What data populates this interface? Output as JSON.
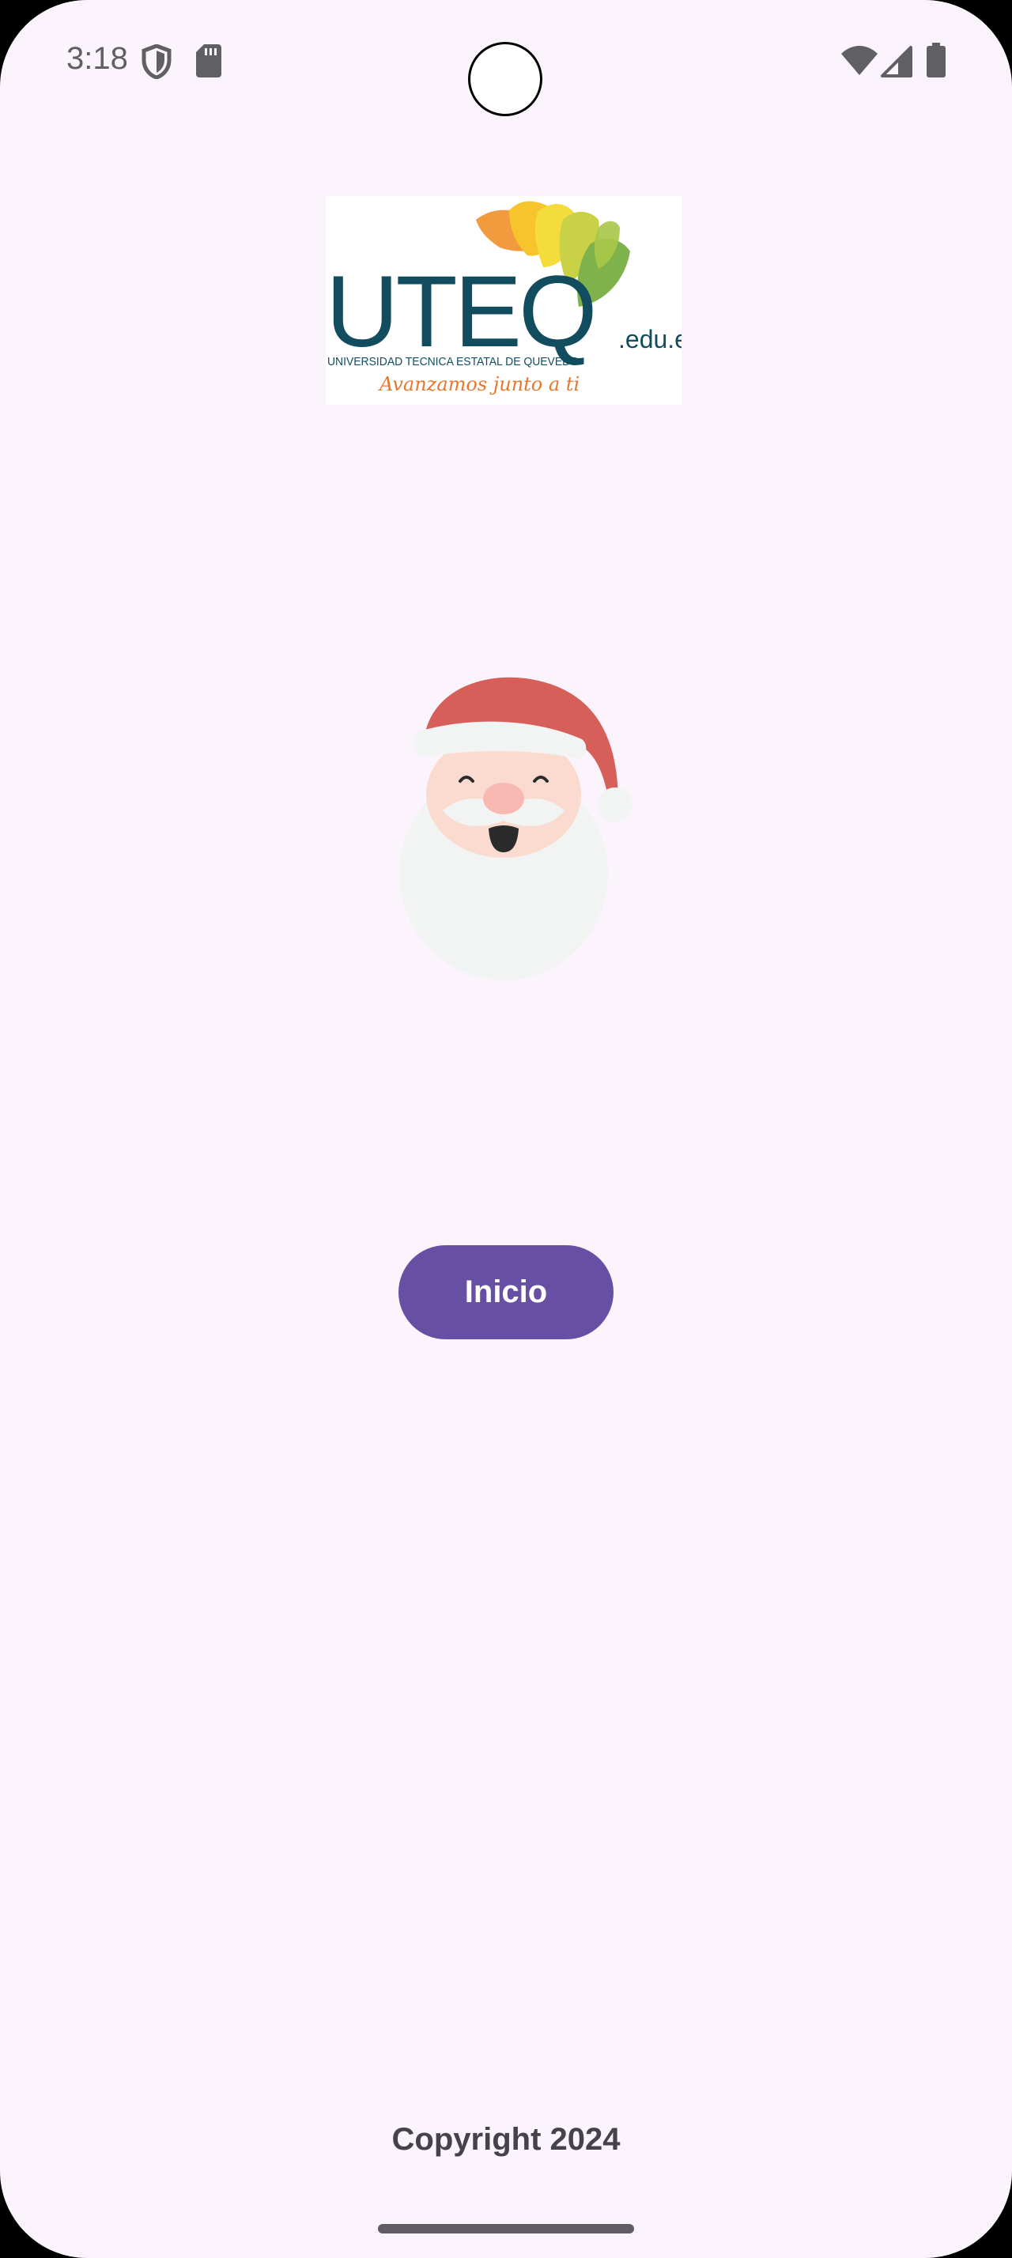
{
  "status_bar": {
    "time": "3:18",
    "icons": [
      "shield-icon",
      "sd-card-icon",
      "wifi-icon",
      "cell-signal-icon",
      "battery-icon"
    ]
  },
  "logo": {
    "wordmark": "UTEQ",
    "domain": ".edu.ec",
    "university_name": "UNIVERSIDAD TECNICA ESTATAL DE QUEVEDO",
    "slogan": "Avanzamos junto a ti",
    "colors": {
      "wordmark": "#124C5F",
      "slogan": "#E8772E"
    }
  },
  "illustration": {
    "icon": "santa-claus-icon"
  },
  "main": {
    "start_button_label": "Inicio"
  },
  "footer": {
    "copyright": "Copyright 2024"
  },
  "colors": {
    "background": "#FCF4FC",
    "accent": "#6750A4",
    "text": "#45434A"
  }
}
